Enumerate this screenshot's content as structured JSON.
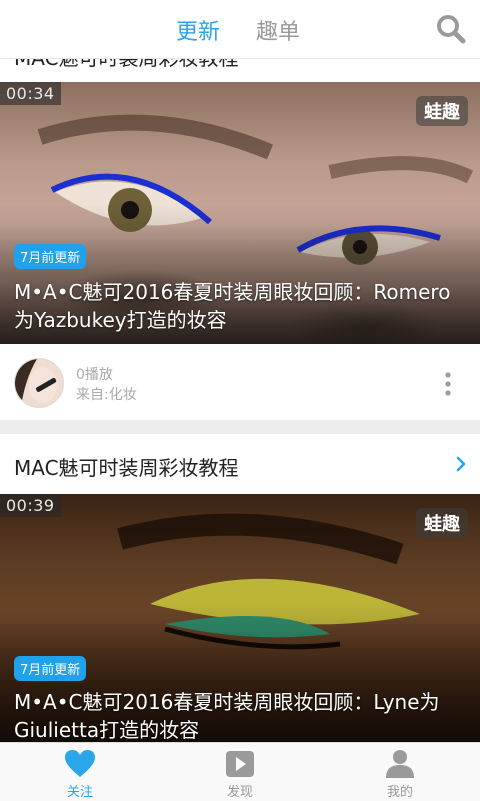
{
  "header": {
    "tabs": [
      {
        "label": "更新",
        "active": true
      },
      {
        "label": "趣单",
        "active": false
      }
    ],
    "search_icon": "search-icon"
  },
  "peek_section": {
    "title": "MAC魅可时装周彩妆教程"
  },
  "videos": [
    {
      "duration": "00:34",
      "watermark": "蛙趣",
      "badge": "7月前更新",
      "title": "M•A•C魅可2016春夏时装周眼妆回顾：Romero为Yazbukey打造的妆容",
      "plays": "0播放",
      "source": "来自:化妆"
    },
    {
      "duration": "00:39",
      "watermark": "蛙趣",
      "badge": "7月前更新",
      "title": "M•A•C魅可2016春夏时装周眼妆回顾：Lyne为Giulietta打造的妆容"
    }
  ],
  "section": {
    "title": "MAC魅可时装周彩妆教程"
  },
  "bottom_nav": [
    {
      "label": "关注",
      "icon": "heart-icon",
      "active": true
    },
    {
      "label": "发现",
      "icon": "play-icon",
      "active": false
    },
    {
      "label": "我的",
      "icon": "person-icon",
      "active": false
    }
  ],
  "colors": {
    "accent": "#29a5e8",
    "badge": "#1fa2ec",
    "inactive": "#999999"
  }
}
